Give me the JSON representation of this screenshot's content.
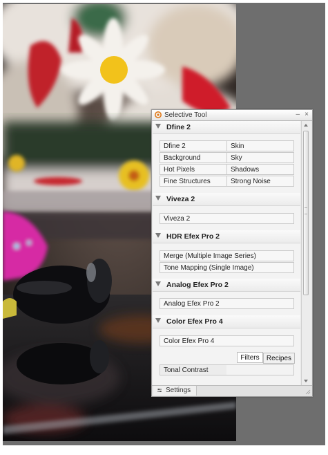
{
  "panel": {
    "title": "Selective Tool",
    "minimize_glyph": "–",
    "close_glyph": "×"
  },
  "sections": {
    "dfine": {
      "title": "Dfine 2",
      "cells": [
        "Dfine 2",
        "Skin",
        "Background",
        "Sky",
        "Hot Pixels",
        "Shadows",
        "Fine Structures",
        "Strong Noise"
      ]
    },
    "viveza": {
      "title": "Viveza 2",
      "cells": [
        "Viveza 2"
      ]
    },
    "hdr": {
      "title": "HDR Efex Pro 2",
      "cells": [
        "Merge (Multiple Image Series)",
        "Tone Mapping (Single Image)"
      ]
    },
    "analog": {
      "title": "Analog Efex Pro 2",
      "cells": [
        "Analog Efex Pro 2"
      ]
    },
    "color": {
      "title": "Color Efex Pro 4",
      "cells": [
        "Color Efex Pro 4"
      ],
      "tabs": [
        "Filters",
        "Recipes"
      ],
      "filter_items": [
        "Tonal Contrast"
      ]
    }
  },
  "footer": {
    "settings_label": "Settings"
  },
  "icons": {
    "title": "nik-logo-icon",
    "settings": "settings-icon",
    "section_toggle": "collapse-triangle-icon",
    "resize": "resize-grip-icon"
  }
}
